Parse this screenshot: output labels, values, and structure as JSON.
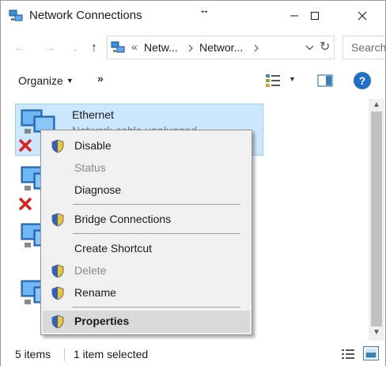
{
  "window": {
    "title": "Network Connections"
  },
  "titlebar": {
    "app_icon": "network-connections-icon",
    "resize_cursor": "↔",
    "minimize_icon": "minimize-icon",
    "maximize_icon": "maximize-icon",
    "close_icon": "close-icon"
  },
  "address": {
    "back_icon": "←",
    "forward_icon": "→",
    "recent_icon": "⌄",
    "up_icon": "↑",
    "overflow": "«",
    "crumbs": [
      "Netw...",
      "Networ..."
    ],
    "dropdown_icon": "⌄",
    "refresh_icon": "↻",
    "search_placeholder": "Search"
  },
  "commandbar": {
    "organize_label": "Organize",
    "organize_caret": "▼",
    "more_label": "»",
    "view_dd": "▼",
    "help_label": "?"
  },
  "items": [
    {
      "name": "Ethernet",
      "status": "Network cable unplugged",
      "disconnected": true,
      "selected": true
    },
    {
      "name": "",
      "status": "",
      "disconnected": true,
      "selected": false
    },
    {
      "name": "",
      "status": "",
      "disconnected": false,
      "selected": false
    },
    {
      "name": "",
      "status": "",
      "disconnected": false,
      "selected": false
    }
  ],
  "scrollbar": {
    "up_icon": "▲",
    "down_icon": "▼"
  },
  "statusbar": {
    "count": "5 items",
    "selected": "1 item selected"
  },
  "context_menu": {
    "items": [
      {
        "label": "Disable",
        "shield": true,
        "disabled": false,
        "bold": false
      },
      {
        "label": "Status",
        "shield": false,
        "disabled": true,
        "bold": false
      },
      {
        "label": "Diagnose",
        "shield": false,
        "disabled": false,
        "bold": false
      },
      {
        "label": "Bridge Connections",
        "shield": true,
        "disabled": false,
        "bold": false
      },
      {
        "label": "Create Shortcut",
        "shield": false,
        "disabled": false,
        "bold": false
      },
      {
        "label": "Delete",
        "shield": true,
        "disabled": true,
        "bold": false
      },
      {
        "label": "Rename",
        "shield": true,
        "disabled": false,
        "bold": false
      },
      {
        "label": "Properties",
        "shield": true,
        "disabled": false,
        "bold": true,
        "highlighted": true
      }
    ]
  },
  "colors": {
    "selection_bg": "#cce8ff",
    "selection_border": "#99d1ff",
    "menu_bg": "#f0f0f0",
    "help_blue": "#1f6fc7",
    "error_red": "#e0201a"
  }
}
